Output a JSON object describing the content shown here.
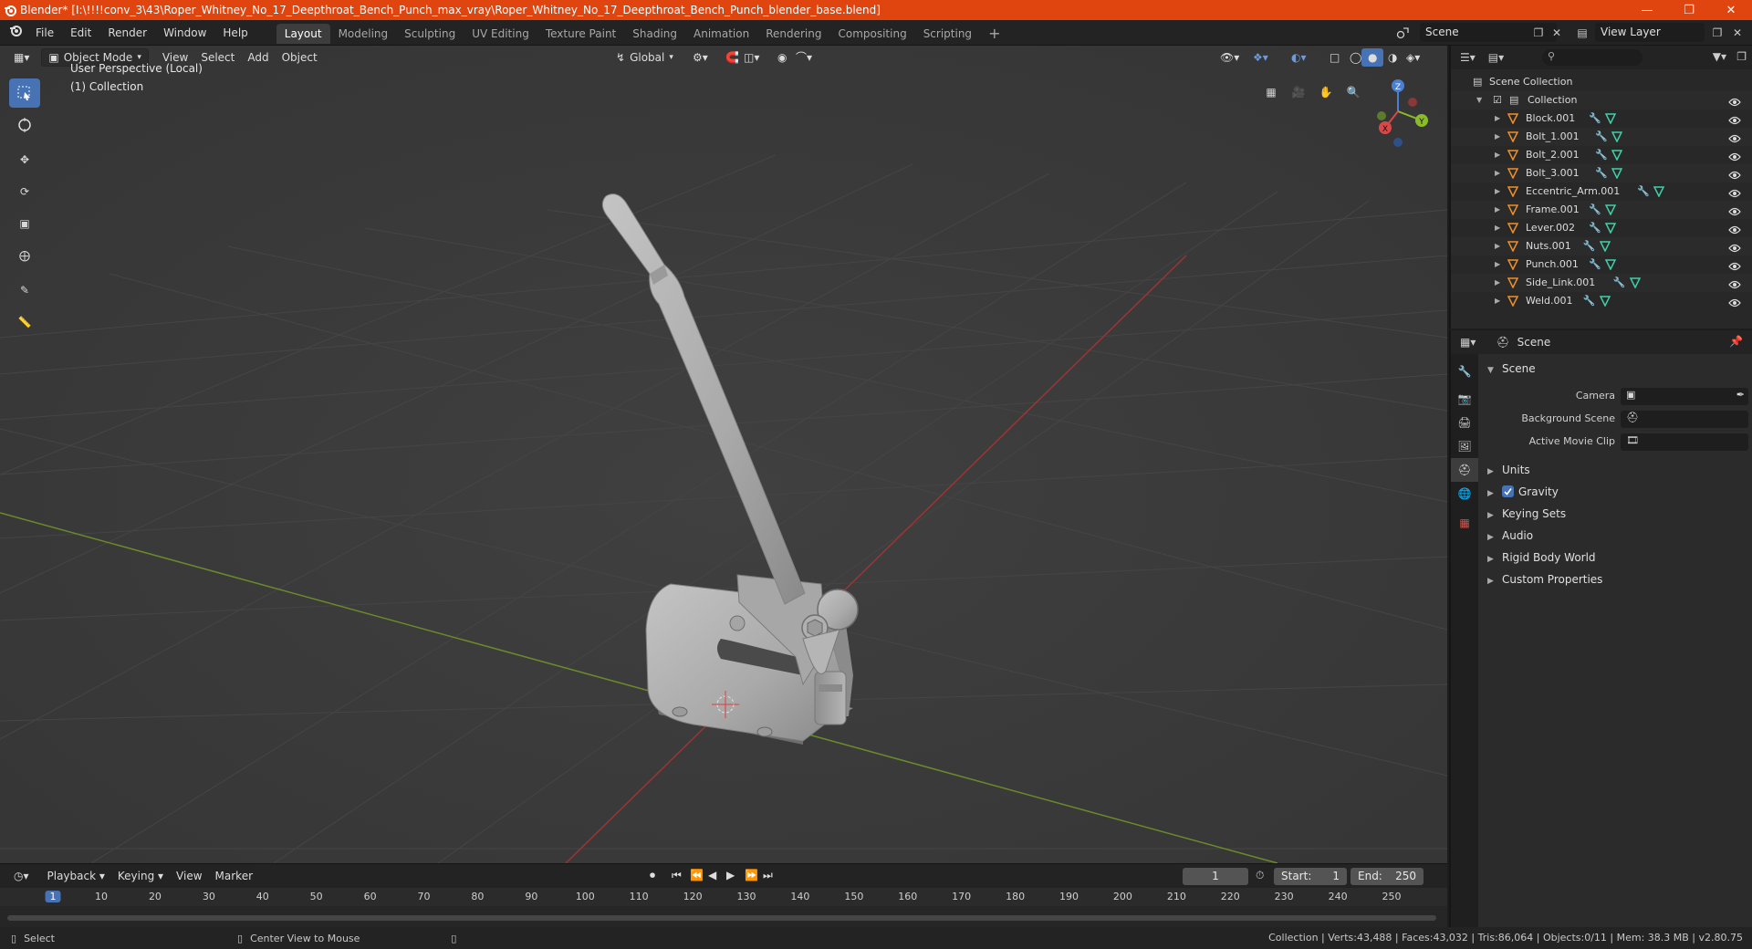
{
  "window": {
    "title": "Blender* [I:\\!!!!conv_3\\43\\Roper_Whitney_No_17_Deepthroat_Bench_Punch_max_vray\\Roper_Whitney_No_17_Deepthroat_Bench_Punch_blender_base.blend]",
    "accent": "#e0450f"
  },
  "menu": [
    "File",
    "Edit",
    "Render",
    "Window",
    "Help"
  ],
  "workspaces": [
    {
      "label": "Layout",
      "active": true
    },
    {
      "label": "Modeling"
    },
    {
      "label": "Sculpting"
    },
    {
      "label": "UV Editing"
    },
    {
      "label": "Texture Paint"
    },
    {
      "label": "Shading"
    },
    {
      "label": "Animation"
    },
    {
      "label": "Rendering"
    },
    {
      "label": "Compositing"
    },
    {
      "label": "Scripting"
    }
  ],
  "scene_selector": "Scene",
  "view_layer": "View Layer",
  "viewport": {
    "mode": "Object Mode",
    "menus": [
      "View",
      "Select",
      "Add",
      "Object"
    ],
    "transform_orientation": "Global",
    "perspective_label": "User Perspective (Local)",
    "collection_label": "(1) Collection",
    "gizmo": {
      "x": "X",
      "y": "Y",
      "z": "Z"
    }
  },
  "timeline": {
    "menus": [
      "Playback",
      "Keying",
      "View",
      "Marker"
    ],
    "current_frame": "1",
    "start_label": "Start:",
    "start": "1",
    "end_label": "End:",
    "end": "250",
    "ticks": [
      "1",
      "10",
      "20",
      "30",
      "40",
      "50",
      "60",
      "70",
      "80",
      "90",
      "100",
      "110",
      "120",
      "130",
      "140",
      "150",
      "160",
      "170",
      "180",
      "190",
      "200",
      "210",
      "220",
      "230",
      "240",
      "250"
    ]
  },
  "statusbar": {
    "left": "Select",
    "middle": "Center View to Mouse",
    "right": "Collection | Verts:43,488 | Faces:43,032 | Tris:86,064 | Objects:0/11 | Mem: 38.3 MB | v2.80.75"
  },
  "outliner": {
    "root": "Scene Collection",
    "collection": "Collection",
    "objects": [
      "Block.001",
      "Bolt_1.001",
      "Bolt_2.001",
      "Bolt_3.001",
      "Eccentric_Arm.001",
      "Frame.001",
      "Lever.002",
      "Nuts.001",
      "Punch.001",
      "Side_Link.001",
      "Weld.001"
    ]
  },
  "properties": {
    "header": "Scene",
    "panel": "Scene",
    "fields": [
      "Camera",
      "Background Scene",
      "Active Movie Clip"
    ],
    "collapsed": [
      "Units",
      "Gravity",
      "Keying Sets",
      "Audio",
      "Rigid Body World",
      "Custom Properties"
    ]
  }
}
